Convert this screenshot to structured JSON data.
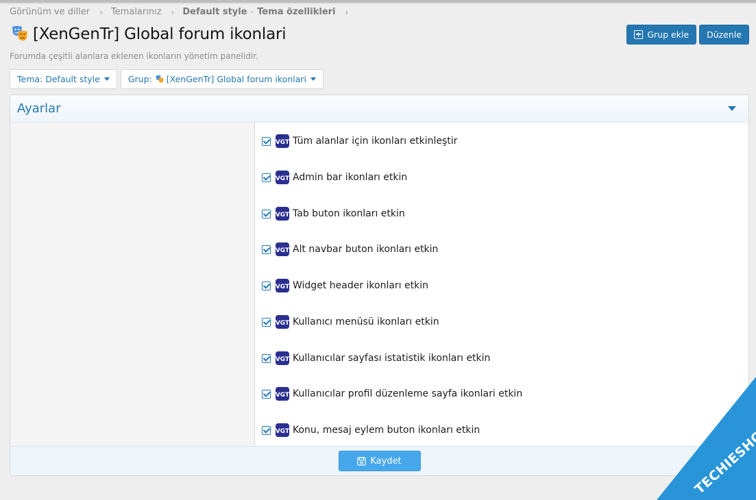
{
  "breadcrumb": {
    "items": [
      "Görünüm ve diller",
      "Temalarınız"
    ],
    "current_style": "Default style",
    "current_page": "Tema özellikleri"
  },
  "header": {
    "title": "[XenGenTr] Global forum ikonlari",
    "description": "Forumda çeşitli alanlara eklenen ikonların yönetim panelidir.",
    "add_group_label": "Grup ekle",
    "edit_label": "Düzenle"
  },
  "filters": {
    "style_label": "Tema: Default style",
    "group_prefix": "Grup:",
    "group_value": "[XenGenTr] Global forum ikonlari"
  },
  "panel": {
    "title": "Ayarlar",
    "options": [
      {
        "label": "Tüm alanlar için ikonları etkinleştir",
        "checked": true
      },
      {
        "label": "Admin bar ikonları etkin",
        "checked": true
      },
      {
        "label": "Tab buton ikonları etkin",
        "checked": true
      },
      {
        "label": "Alt navbar buton ikonları etkin",
        "checked": true
      },
      {
        "label": "Widget header ikonları etkin",
        "checked": true
      },
      {
        "label": "Kullanıcı menüsü ikonları etkin",
        "checked": true
      },
      {
        "label": "Kullanıcılar sayfası istatistik ikonları etkin",
        "checked": true
      },
      {
        "label": "Kullanıcılar profil düzenleme sayfa ikonlari etkin",
        "checked": true
      },
      {
        "label": "Konu, mesaj eylem buton ikonları etkin",
        "checked": true
      }
    ],
    "save_label": "Kaydet"
  },
  "watermark": {
    "text": "TECHIESHOME.COM"
  },
  "colors": {
    "accent": "#2577b1",
    "save_button": "#47a7eb",
    "watermark": "#1e8fd6"
  }
}
